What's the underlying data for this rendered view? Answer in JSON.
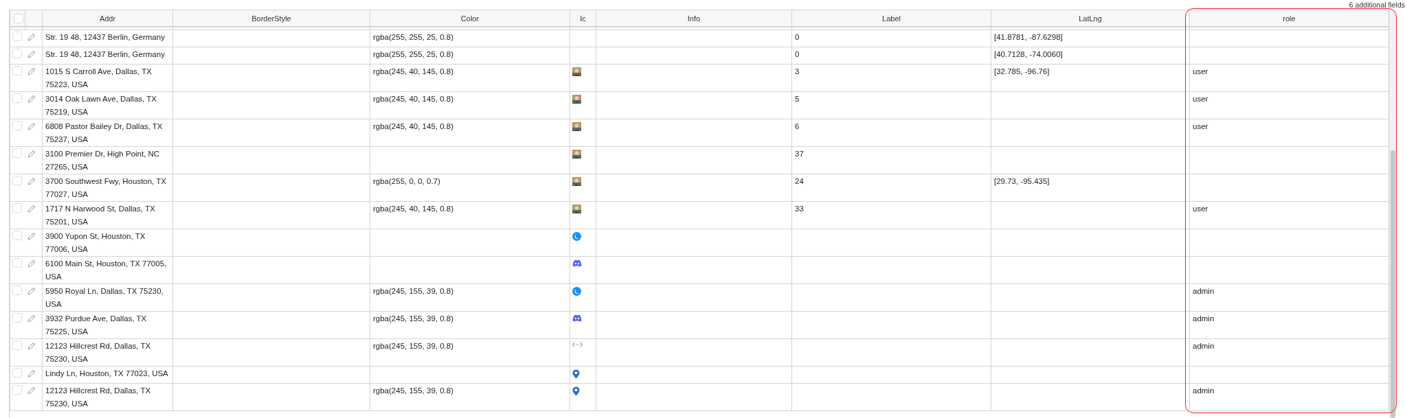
{
  "fields_note": "6 additional fields",
  "select_all": {
    "checked": false
  },
  "columns": [
    {
      "label": "Addr",
      "highlighted": false
    },
    {
      "label": "BorderStyle",
      "highlighted": false
    },
    {
      "label": "Color",
      "highlighted": false
    },
    {
      "label": "Ic",
      "highlighted": false
    },
    {
      "label": "Info",
      "highlighted": false
    },
    {
      "label": "Label",
      "highlighted": false
    },
    {
      "label": "LatLng",
      "highlighted": false
    },
    {
      "label": "role",
      "highlighted": true
    }
  ],
  "rows": [
    {
      "checked": false,
      "addr": "Str. 19 48, 12437 Berlin, Germany",
      "color_text": "rgba(255, 255, 25, 0.8)",
      "label": "0",
      "latlng": "[41.8781, -87.6298]"
    },
    {
      "checked": false,
      "addr": "Str. 19 48, 12437 Berlin, Germany",
      "color_text": "rgba(255, 255, 25, 0.8)",
      "label": "0",
      "latlng": "[40.7128, -74.0060]"
    },
    {
      "checked": false,
      "addr": "1015 S Carroll Ave, Dallas, TX 75223, USA",
      "color_text": "rgba(245, 40, 145, 0.8)",
      "ic": {
        "kind": "photo"
      },
      "label": "3",
      "latlng": "[32.785, -96.76]",
      "role": "user"
    },
    {
      "checked": false,
      "addr": "3014 Oak Lawn Ave, Dallas, TX 75219, USA",
      "color_text": "rgba(245, 40, 145, 0.8)",
      "ic": {
        "kind": "photo"
      },
      "label": "5",
      "role": "user"
    },
    {
      "checked": false,
      "addr": "6808 Pastor Bailey Dr, Dallas, TX 75237, USA",
      "color_text": "rgba(245, 40, 145, 0.8)",
      "ic": {
        "kind": "photo"
      },
      "label": "6",
      "role": "user"
    },
    {
      "checked": false,
      "addr": "3100 Premier Dr, High Point, NC 27265, USA",
      "ic": {
        "kind": "photo"
      },
      "label": "37"
    },
    {
      "checked": false,
      "addr": "3700 Southwest Fwy, Houston, TX 77027, USA",
      "color_text": "rgba(255, 0, 0, 0.7)",
      "ic": {
        "kind": "photo"
      },
      "label": "24",
      "latlng": "[29.73, -95.435]"
    },
    {
      "checked": false,
      "addr": "1717 N Harwood St, Dallas, TX 75201, USA",
      "color_text": "rgba(245, 40, 145, 0.8)",
      "ic": {
        "kind": "photo"
      },
      "label": "33",
      "role": "user"
    },
    {
      "checked": false,
      "addr": "3900 Yupon St, Houston, TX 77006, USA",
      "ic": {
        "kind": "moon"
      }
    },
    {
      "checked": false,
      "addr": "6100 Main St, Houston, TX 77005, USA",
      "ic": {
        "kind": "controller"
      }
    },
    {
      "checked": false,
      "addr": "5950 Royal Ln, Dallas, TX 75230, USA",
      "color_text": "rgba(245, 155, 39, 0.8)",
      "ic": {
        "kind": "moon"
      },
      "role": "admin"
    },
    {
      "checked": false,
      "addr": "3932 Purdue Ave, Dallas, TX 75225, USA",
      "color_text": "rgba(245, 155, 39, 0.8)",
      "ic": {
        "kind": "controller"
      },
      "role": "admin"
    },
    {
      "checked": false,
      "addr": "12123 Hillcrest Rd, Dallas, TX 75230, USA",
      "color_text": "rgba(245, 155, 39, 0.8)",
      "ic": {
        "kind": "code"
      },
      "role": "admin"
    },
    {
      "checked": false,
      "addr": "Lindy Ln, Houston, TX 77023, USA",
      "ic": {
        "kind": "pin"
      }
    },
    {
      "checked": false,
      "addr": "12123 Hillcrest Rd, Dallas, TX 75230, USA",
      "color_text": "rgba(245, 155, 39, 0.8)",
      "ic": {
        "kind": "pin"
      },
      "role": "admin"
    }
  ]
}
